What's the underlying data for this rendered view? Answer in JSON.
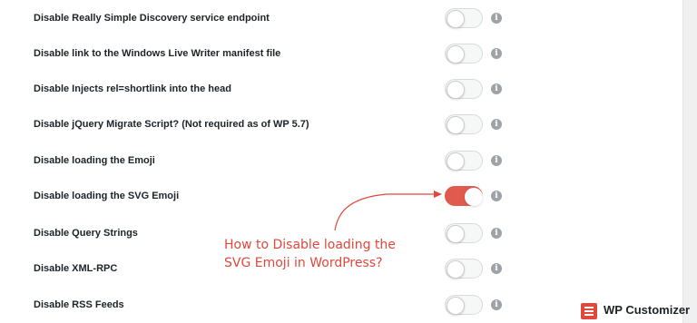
{
  "settings": [
    {
      "label": "Disable Really Simple Discovery service endpoint",
      "enabled": false
    },
    {
      "label": "Disable link to the Windows Live Writer manifest file",
      "enabled": false
    },
    {
      "label": "Disable Injects rel=shortlink into the head",
      "enabled": false
    },
    {
      "label": "Disable jQuery Migrate Script? (Not required as of WP 5.7)",
      "enabled": false
    },
    {
      "label": "Disable loading the Emoji",
      "enabled": false
    },
    {
      "label": "Disable loading the SVG Emoji",
      "enabled": true
    },
    {
      "label": "Disable Query Strings",
      "enabled": false
    },
    {
      "label": "Disable XML-RPC",
      "enabled": false
    },
    {
      "label": "Disable RSS Feeds",
      "enabled": false
    }
  ],
  "info_icon": "info-icon",
  "annotation": {
    "line1": "How to Disable loading the",
    "line2": "SVG Emoji in WordPress?"
  },
  "brand": {
    "name": "WP Customizer"
  },
  "colors": {
    "accent": "#e05a4e",
    "annotation": "#e0483b",
    "text": "#1d2327"
  }
}
